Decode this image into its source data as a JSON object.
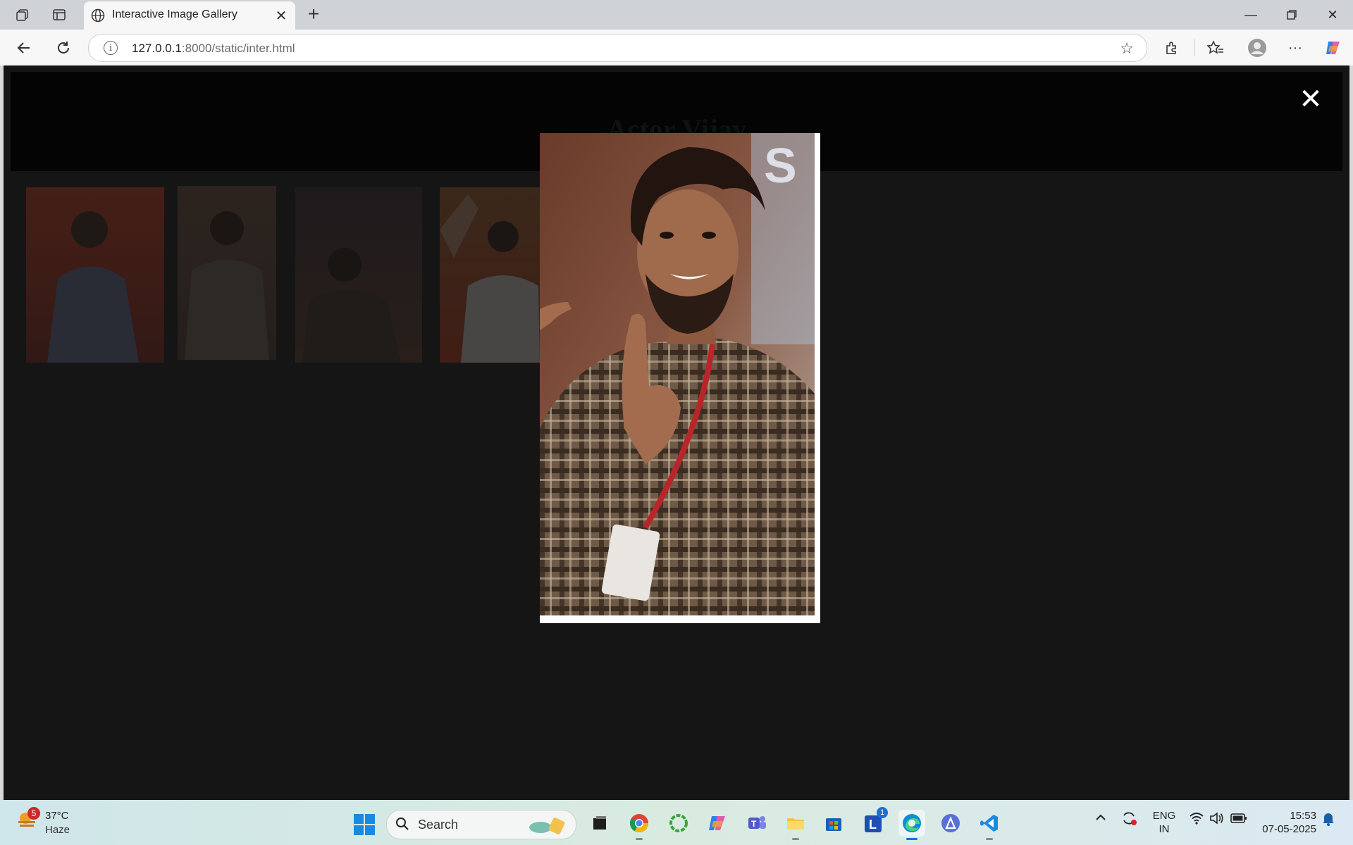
{
  "browser": {
    "tab_title": "Interactive Image Gallery",
    "url_host": "127.0.0.1",
    "url_path": ":8000/static/inter.html"
  },
  "page": {
    "title": "Actor Vijay",
    "close_symbol": "✕"
  },
  "gallery": {
    "thumbnails": [
      "thumbnail-1",
      "thumbnail-2",
      "thumbnail-3",
      "thumbnail-4"
    ],
    "open_image": "enlarged-photo"
  },
  "taskbar": {
    "weather_temp": "37°C",
    "weather_desc": "Haze",
    "weather_badge": "5",
    "search_label": "Search",
    "lang_top": "ENG",
    "lang_bottom": "IN",
    "time": "15:53",
    "date": "07-05-2025",
    "teams_badge": "1"
  },
  "colors": {
    "overlay": "#151515",
    "header": "#040404",
    "accent": "#1a8ae0"
  }
}
